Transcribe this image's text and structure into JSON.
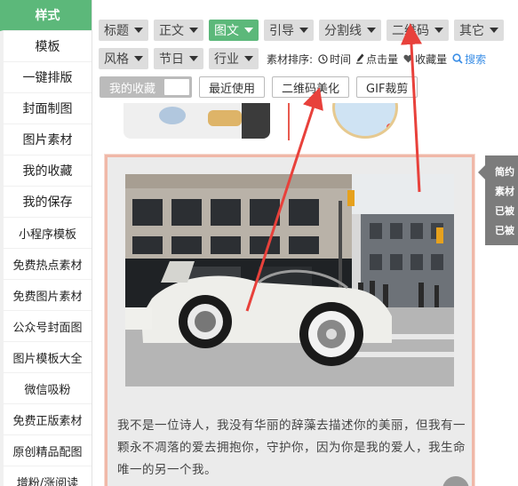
{
  "sidebar": {
    "items": [
      {
        "label": "样式",
        "active": true
      },
      {
        "label": "模板"
      },
      {
        "label": "一键排版"
      },
      {
        "label": "封面制图"
      },
      {
        "label": "图片素材"
      },
      {
        "label": "我的收藏"
      },
      {
        "label": "我的保存"
      },
      {
        "label": "小程序模板"
      },
      {
        "label": "免费热点素材"
      },
      {
        "label": "免费图片素材"
      },
      {
        "label": "公众号封面图"
      },
      {
        "label": "图片模板大全"
      },
      {
        "label": "微信吸粉"
      },
      {
        "label": "免费正版素材"
      },
      {
        "label": "原创精品配图"
      },
      {
        "label": "增粉/涨阅读"
      }
    ]
  },
  "toolbar": {
    "row1": [
      "标题",
      "正文",
      "图文",
      "引导",
      "分割线",
      "二维码",
      "其它"
    ],
    "row1_active": "图文",
    "row2": [
      "风格",
      "节日",
      "行业"
    ],
    "sort_label": "素材排序:",
    "sort_options": [
      {
        "label": "时间",
        "icon": "clock-icon"
      },
      {
        "label": "点击量",
        "icon": "pen-icon"
      },
      {
        "label": "收藏量",
        "icon": "heart-icon"
      },
      {
        "label": "搜索",
        "icon": "search-icon"
      }
    ],
    "tabs": [
      "我的收藏",
      "最近使用",
      "二维码美化",
      "GIF裁剪"
    ]
  },
  "card": {
    "text": "我不是一位诗人，我没有华丽的辞藻去描述你的美丽，但我有一颗永不凋落的爱去拥抱你，守护你，因为你是我的爱人，我生命唯一的另一个我。"
  },
  "tooltip": {
    "lines": [
      "简约",
      "素材",
      "已被",
      "已被"
    ]
  },
  "colors": {
    "accent": "#5cb87a",
    "annotation": "#e8413b",
    "search": "#3a8ee6"
  }
}
